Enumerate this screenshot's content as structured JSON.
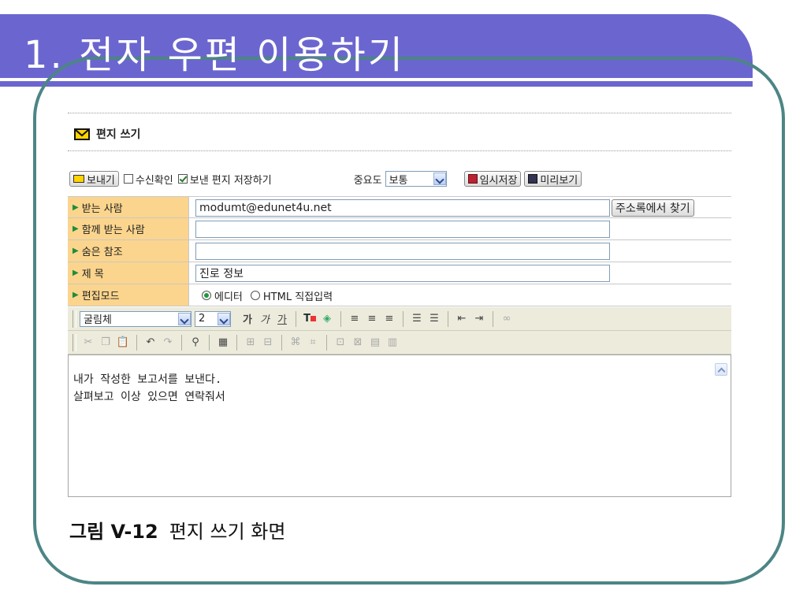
{
  "slide": {
    "title": "1. 전자 우편 이용하기",
    "caption_label": "그림 V-12",
    "caption_text": "편지 쓰기 화면"
  },
  "compose": {
    "header": "편지 쓰기",
    "send_label": "보내기",
    "read_receipt_label": "수신확인",
    "save_sent_label": "보낸 편지 저장하기",
    "priority_label": "중요도",
    "priority_value": "보통",
    "temp_save_label": "임시저장",
    "preview_label": "미리보기",
    "fields": {
      "to_label": "받는 사람",
      "to_value": "modumt@edunet4u.net",
      "addressbook_label": "주소록에서 찾기",
      "cc_label": "함께 받는 사람",
      "cc_value": "",
      "bcc_label": "숨은 참조",
      "bcc_value": "",
      "subject_label": "제 목",
      "subject_value": "진로 정보",
      "mode_label": "편집모드",
      "mode_editor": "에디터",
      "mode_html": "HTML 직접입력"
    },
    "editor": {
      "font_value": "굴림체",
      "size_value": "2",
      "line1": "내가 작성한 보고서를 보낸다.",
      "line2": "살펴보고 이상 있으면 연락줘서"
    }
  },
  "colors": {
    "title_band": "#6b66cf",
    "frame": "#4d8585",
    "label_bg": "#fbd58d",
    "editor_toolbar": "#ecebdc"
  }
}
